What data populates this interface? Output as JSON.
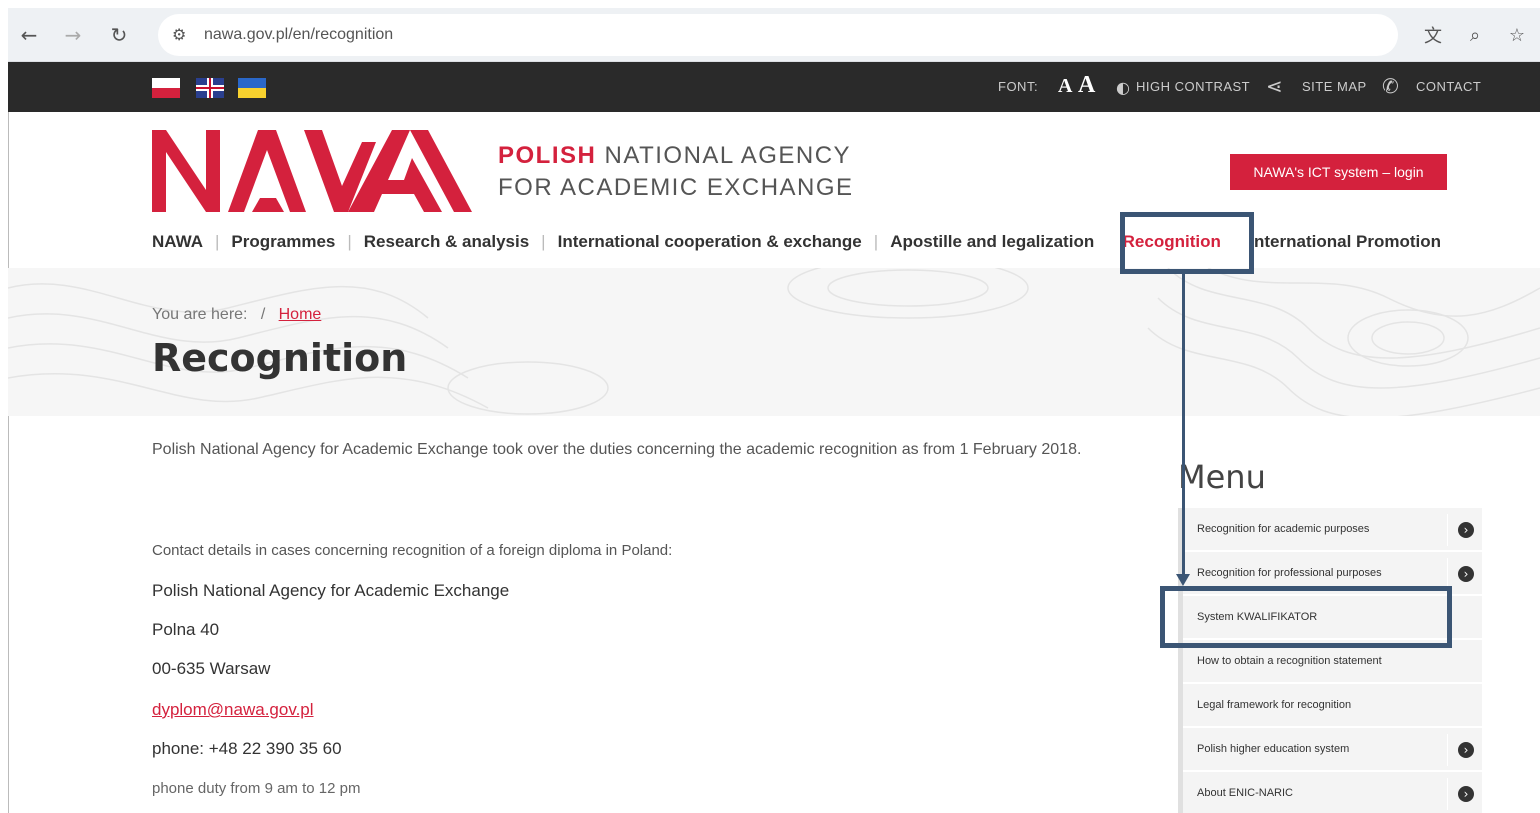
{
  "browser": {
    "url": "nawa.gov.pl/en/recognition",
    "back_icon": "arrow-left-icon",
    "forward_icon": "arrow-right-icon",
    "reload_icon": "reload-icon"
  },
  "topbar": {
    "font_label": "FONT:",
    "aa_small": "A",
    "aa_large": "A",
    "high_contrast": "HIGH CONTRAST",
    "site_map": "SITE MAP",
    "contact": "CONTACT"
  },
  "header": {
    "agency_line1_bold": "POLISH",
    "agency_line1_rest": " NATIONAL AGENCY",
    "agency_line2": "FOR ACADEMIC EXCHANGE",
    "login_button": "NAWA's ICT system – login"
  },
  "mainnav": {
    "items": [
      "NAWA",
      "Programmes",
      "Research & analysis",
      "International cooperation & exchange",
      "Apostille and legalization",
      "Recognition",
      "International Promotion"
    ]
  },
  "breadcrumb": {
    "label": "You are here:",
    "separator": "/",
    "home": "Home"
  },
  "page": {
    "title": "Recognition",
    "intro": "Polish National Agency for Academic Exchange took over the duties concerning the academic recognition as from 1 February 2018.",
    "contact_lead": "Contact details in cases concerning recognition of a foreign diploma in Poland:",
    "org": "Polish National Agency for Academic Exchange",
    "street": "Polna 40",
    "city": "00-635 Warsaw",
    "email": "dyplom@nawa.gov.pl",
    "phone": "phone: +48 22 390 35 60",
    "phone_duty": "phone duty from 9 am to 12 pm"
  },
  "side_menu": {
    "title": "Menu",
    "items": [
      "Recognition for academic purposes",
      "Recognition for professional purposes",
      "System KWALIFIKATOR",
      "How to obtain a recognition statement",
      "Legal framework for recognition",
      "Polish higher education system",
      "About ENIC-NARIC"
    ]
  },
  "colors": {
    "brand_red": "#d4213d",
    "annotation_blue": "#3b5574",
    "topbar_dark": "#2a2a2a"
  }
}
